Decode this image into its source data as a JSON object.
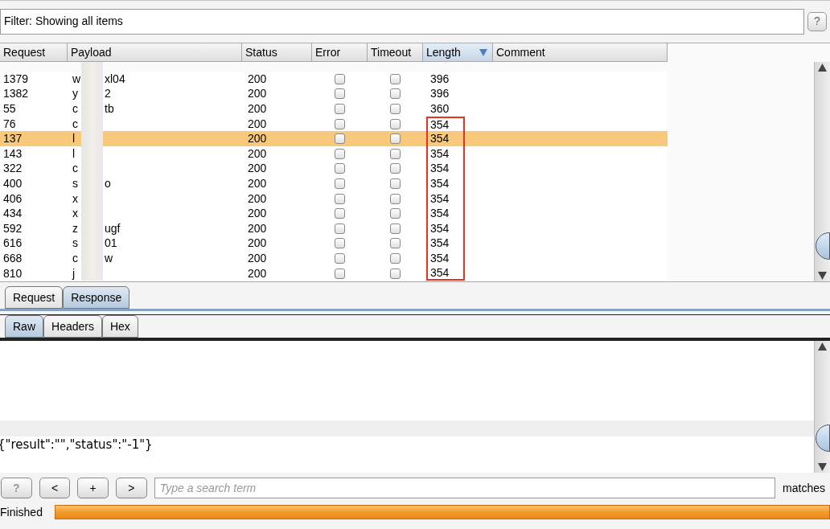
{
  "filter": {
    "text": "Filter: Showing all items",
    "help": "?"
  },
  "table": {
    "columns": [
      {
        "label": "Request",
        "sorted": false
      },
      {
        "label": "Payload",
        "sorted": false
      },
      {
        "label": "Status",
        "sorted": false
      },
      {
        "label": "Error",
        "sorted": false
      },
      {
        "label": "Timeout",
        "sorted": false
      },
      {
        "label": "Length",
        "sorted": true
      },
      {
        "label": "Comment",
        "sorted": false
      }
    ],
    "rows": [
      {
        "request": "1379",
        "payload_start": "w",
        "payload_end": "xl04",
        "status": "200",
        "error": false,
        "timeout": false,
        "length": "396",
        "selected": false,
        "flagged": false
      },
      {
        "request": "1382",
        "payload_start": "y",
        "payload_end": "2",
        "status": "200",
        "error": false,
        "timeout": false,
        "length": "396",
        "selected": false,
        "flagged": false
      },
      {
        "request": "55",
        "payload_start": "c",
        "payload_end": "tb",
        "status": "200",
        "error": false,
        "timeout": false,
        "length": "360",
        "selected": false,
        "flagged": false
      },
      {
        "request": "76",
        "payload_start": "c",
        "status": "200",
        "error": false,
        "timeout": false,
        "length": "354",
        "selected": false,
        "flagged": true
      },
      {
        "request": "137",
        "payload_start": "l",
        "status": "200",
        "error": false,
        "timeout": false,
        "length": "354",
        "selected": true,
        "flagged": true
      },
      {
        "request": "143",
        "payload_start": "l",
        "status": "200",
        "error": false,
        "timeout": false,
        "length": "354",
        "selected": false,
        "flagged": true
      },
      {
        "request": "322",
        "payload_start": "c",
        "status": "200",
        "error": false,
        "timeout": false,
        "length": "354",
        "selected": false,
        "flagged": true
      },
      {
        "request": "400",
        "payload_start": "s",
        "payload_end": "o",
        "status": "200",
        "error": false,
        "timeout": false,
        "length": "354",
        "selected": false,
        "flagged": true
      },
      {
        "request": "406",
        "payload_start": "x",
        "status": "200",
        "error": false,
        "timeout": false,
        "length": "354",
        "selected": false,
        "flagged": true
      },
      {
        "request": "434",
        "payload_start": "x",
        "status": "200",
        "error": false,
        "timeout": false,
        "length": "354",
        "selected": false,
        "flagged": true
      },
      {
        "request": "592",
        "payload_start": "z",
        "payload_end": "ugf",
        "status": "200",
        "error": false,
        "timeout": false,
        "length": "354",
        "selected": false,
        "flagged": true
      },
      {
        "request": "616",
        "payload_start": "s",
        "payload_end": "01",
        "status": "200",
        "error": false,
        "timeout": false,
        "length": "354",
        "selected": false,
        "flagged": true
      },
      {
        "request": "668",
        "payload_start": "c",
        "payload_end": "w",
        "status": "200",
        "error": false,
        "timeout": false,
        "length": "354",
        "selected": false,
        "flagged": true
      },
      {
        "request": "810",
        "payload_start": "j",
        "status": "200",
        "error": false,
        "timeout": false,
        "length": "354",
        "selected": false,
        "flagged": true
      }
    ]
  },
  "message_tabs": [
    {
      "label": "Request",
      "selected": false
    },
    {
      "label": "Response",
      "selected": true
    }
  ],
  "view_tabs": [
    {
      "label": "Raw",
      "selected": true
    },
    {
      "label": "Headers",
      "selected": false
    },
    {
      "label": "Hex",
      "selected": false
    }
  ],
  "response_body": "{\"result\":\"\",\"status\":\"-1\"}",
  "search": {
    "buttons": [
      "?",
      "<",
      "+",
      ">"
    ],
    "placeholder": "Type a search term",
    "matches": "matches"
  },
  "status_bar": {
    "text": "Finished",
    "level": 1
  }
}
